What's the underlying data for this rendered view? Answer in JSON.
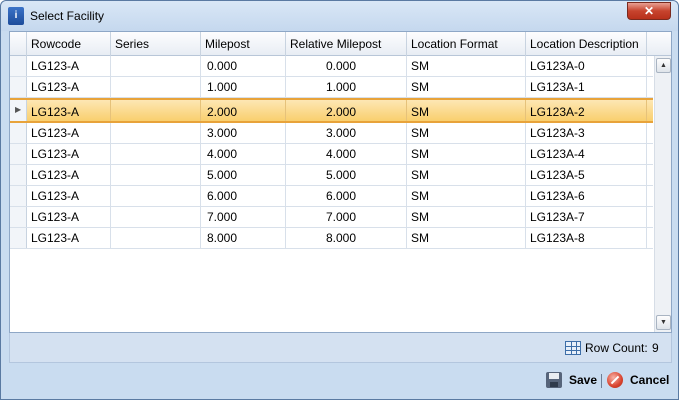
{
  "window": {
    "title": "Select Facility",
    "close_label": "✕"
  },
  "grid": {
    "columns": [
      "Rowcode",
      "Series",
      "Milepost",
      "Relative Milepost",
      "Location Format",
      "Location Description"
    ],
    "rows": [
      [
        "LG123-A",
        "",
        "0.000",
        "0.000",
        "SM",
        "LG123A-0"
      ],
      [
        "LG123-A",
        "",
        "1.000",
        "1.000",
        "SM",
        "LG123A-1"
      ],
      [
        "LG123-A",
        "",
        "2.000",
        "2.000",
        "SM",
        "LG123A-2"
      ],
      [
        "LG123-A",
        "",
        "3.000",
        "3.000",
        "SM",
        "LG123A-3"
      ],
      [
        "LG123-A",
        "",
        "4.000",
        "4.000",
        "SM",
        "LG123A-4"
      ],
      [
        "LG123-A",
        "",
        "5.000",
        "5.000",
        "SM",
        "LG123A-5"
      ],
      [
        "LG123-A",
        "",
        "6.000",
        "6.000",
        "SM",
        "LG123A-6"
      ],
      [
        "LG123-A",
        "",
        "7.000",
        "7.000",
        "SM",
        "LG123A-7"
      ],
      [
        "LG123-A",
        "",
        "8.000",
        "8.000",
        "SM",
        "LG123A-8"
      ]
    ],
    "selected_row": 2
  },
  "status": {
    "row_count_label": "Row Count:",
    "row_count_value": "9"
  },
  "footer": {
    "save_label": "Save",
    "cancel_label": "Cancel"
  },
  "icons": {
    "app": "facility-icon",
    "row_count": "table-icon",
    "save": "floppy-disk-icon",
    "cancel": "cancel-circle-icon"
  },
  "colors": {
    "selection": "#f9cf6e",
    "selection_border": "#e8a33a",
    "chrome": "#c9dcf0"
  }
}
